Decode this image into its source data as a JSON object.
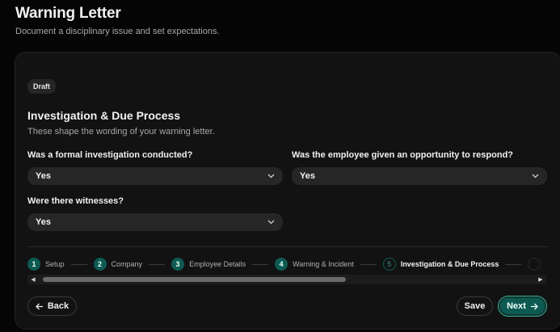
{
  "header": {
    "title": "Warning Letter",
    "subtitle": "Document a disciplinary issue and set expectations."
  },
  "card": {
    "badge": "Draft",
    "section_title": "Investigation & Due Process",
    "section_desc": "These shape the wording of your warning letter."
  },
  "fields": {
    "investigation": {
      "label": "Was a formal investigation conducted?",
      "value": "Yes"
    },
    "opportunity": {
      "label": "Was the employee given an opportunity to respond?",
      "value": "Yes"
    },
    "witnesses": {
      "label": "Were there witnesses?",
      "value": "Yes"
    }
  },
  "steps": [
    {
      "num": "1",
      "label": "Setup"
    },
    {
      "num": "2",
      "label": "Company"
    },
    {
      "num": "3",
      "label": "Employee Details"
    },
    {
      "num": "4",
      "label": "Warning & Incident"
    },
    {
      "num": "5",
      "label": "Investigation & Due Process"
    }
  ],
  "active_step": 5,
  "buttons": {
    "back": "Back",
    "save": "Save",
    "next": "Next"
  },
  "colors": {
    "accent": "#0d5a52",
    "background": "#050505",
    "card": "#121212",
    "input": "#262626"
  },
  "icons": {
    "chevron": "chevron-down-icon",
    "back": "arrow-left-icon",
    "next": "arrow-right-icon"
  }
}
